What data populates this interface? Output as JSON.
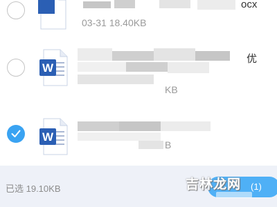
{
  "file_list": {
    "rows": [
      {
        "name_fragment": "ocx",
        "meta_fragment": "03-31 18.40KB",
        "selected": false,
        "icon": "word-doc-icon"
      },
      {
        "name_fragment": "优",
        "meta_fragment": "KB",
        "selected": false,
        "icon": "word-doc-icon"
      },
      {
        "name_fragment": "",
        "meta_fragment": "B",
        "selected": true,
        "icon": "word-doc-icon"
      }
    ]
  },
  "bottom_bar": {
    "selected_size_label": "已选 19.10KB",
    "send_count": "(1)"
  },
  "watermark": {
    "text": "吉林龙网"
  },
  "colors": {
    "accent": "#3aa3f2",
    "send_button": "#4fb0f6",
    "word_blue": "#2b5fb4",
    "bottom_bar_bg": "#eef1f8"
  }
}
